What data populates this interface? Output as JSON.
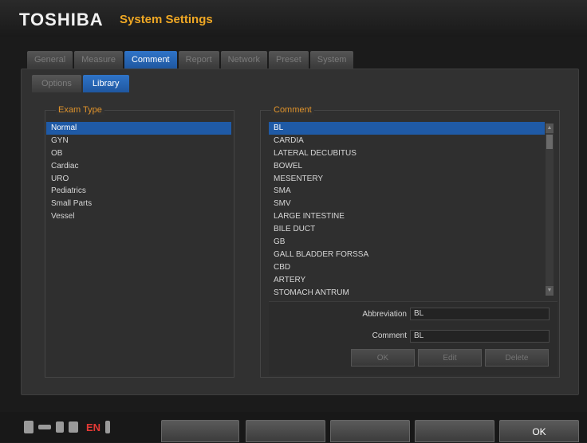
{
  "header": {
    "brand": "TOSHIBA",
    "title": "System Settings"
  },
  "tabs": [
    {
      "label": "General",
      "active": false
    },
    {
      "label": "Measure",
      "active": false
    },
    {
      "label": "Comment",
      "active": true
    },
    {
      "label": "Report",
      "active": false
    },
    {
      "label": "Network",
      "active": false
    },
    {
      "label": "Preset",
      "active": false
    },
    {
      "label": "System",
      "active": false
    }
  ],
  "subtabs": [
    {
      "label": "Options",
      "active": false
    },
    {
      "label": "Library",
      "active": true
    }
  ],
  "exam_type": {
    "title": "Exam Type",
    "items": [
      "Normal",
      "GYN",
      "OB",
      "Cardiac",
      "URO",
      "Pediatrics",
      "Small Parts",
      "Vessel"
    ],
    "selected_index": 0
  },
  "comment": {
    "title": "Comment",
    "items": [
      "BL",
      "CARDIA",
      "LATERAL DECUBITUS",
      "BOWEL",
      "MESENTERY",
      "SMA",
      "SMV",
      "LARGE INTESTINE",
      "BILE DUCT",
      "GB",
      "GALL BLADDER FORSSA",
      "CBD",
      "ARTERY",
      "STOMACH ANTRUM"
    ],
    "selected_index": 0
  },
  "editor": {
    "abbreviation_label": "Abbreviation",
    "abbreviation_value": "BL",
    "comment_label": "Comment",
    "comment_value": "BL",
    "ok_label": "OK",
    "edit_label": "Edit",
    "delete_label": "Delete"
  },
  "status": {
    "language": "EN",
    "icons": [
      "usb-icon",
      "usb-plug-icon",
      "storage-icon",
      "network-icon",
      "battery-icon"
    ]
  },
  "bottom_bar": {
    "ok_label": "OK"
  }
}
